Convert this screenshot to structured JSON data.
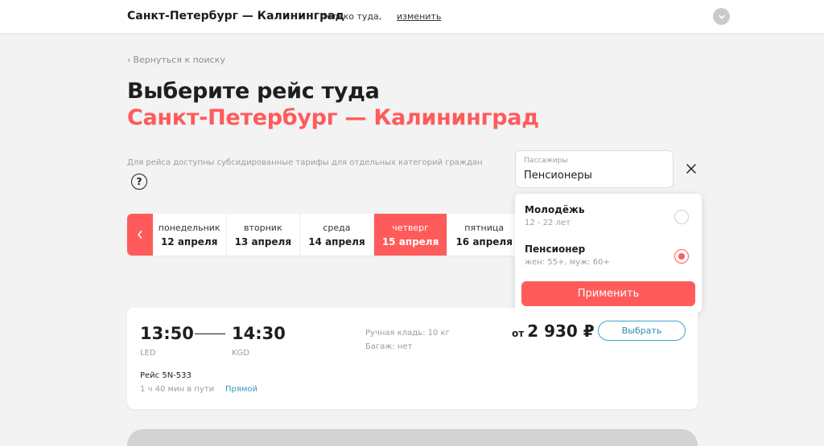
{
  "header": {
    "route": "Санкт-Петербург — Калининград",
    "trip_type": "только туда,",
    "change_label": "изменить"
  },
  "back_label": "Вернуться к поиску",
  "title": "Выберите рейс туда",
  "subtitle_route": "Санкт-Петербург — Калининград",
  "subsidy_note": "Для рейса доступны субсидированные тарифы для отдельных категорий граждан",
  "help_symbol": "?",
  "dates": [
    {
      "weekday": "понедельник",
      "date": "12 апреля",
      "active": false
    },
    {
      "weekday": "вторник",
      "date": "13 апреля",
      "active": false
    },
    {
      "weekday": "среда",
      "date": "14 апреля",
      "active": false
    },
    {
      "weekday": "четверг",
      "date": "15 апреля",
      "active": true
    },
    {
      "weekday": "пятница",
      "date": "16 апреля",
      "active": false
    }
  ],
  "passengers": {
    "label": "Пассажиры",
    "value": "Пенсионеры"
  },
  "dropdown": {
    "options": [
      {
        "title": "Молодёжь",
        "subtitle": "12 - 22 лет",
        "selected": false
      },
      {
        "title": "Пенсионер",
        "subtitle": "жен: 55+, муж: 60+",
        "selected": true
      }
    ],
    "apply_label": "Применить"
  },
  "flight": {
    "dep_time": "13:50",
    "arr_time": "14:30",
    "dep_code": "LED",
    "arr_code": "KGD",
    "hand_luggage": "Ручная кладь: 10 кг",
    "baggage": "Багаж: нет",
    "price_prefix": "от",
    "price": "2 930 ₽",
    "select_label": "Выбрать",
    "flight_number": "Рейс 5N-533",
    "duration": "1 ч 40 мин в пути",
    "direct_label": "Прямой"
  },
  "colors": {
    "accent": "#ff5b5b",
    "link": "#2c9cc0",
    "background": "#f3f3f4"
  },
  "icons": {
    "avatar": "chevron-down-icon",
    "back": "chevron-left-icon",
    "close": "close-icon",
    "prev": "chevron-left-icon"
  }
}
